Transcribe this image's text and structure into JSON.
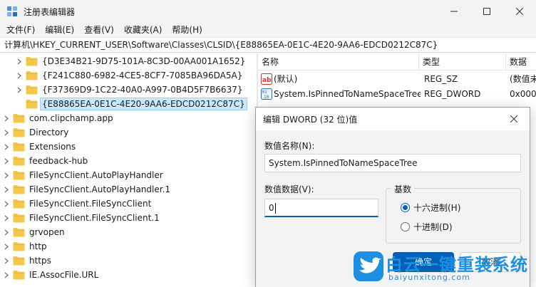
{
  "window": {
    "title": "注册表编辑器",
    "icon": "regedit-icon"
  },
  "menu": [
    "文件(F)",
    "编辑(E)",
    "查看(V)",
    "收藏夹(A)",
    "帮助(H)"
  ],
  "address": "计算机\\HKEY_CURRENT_USER\\Software\\Classes\\CLSID\\{E88865EA-0E1C-4E20-9AA6-EDCD0212C87C}",
  "tree": {
    "items": [
      {
        "label": "{D3E34B21-9D75-101A-8C3D-00AA001A1652}",
        "level": 2,
        "expander": true,
        "selected": false
      },
      {
        "label": "{F241C880-6982-4CE5-8CF7-7085BA96DA5A}",
        "level": 2,
        "expander": true,
        "selected": false
      },
      {
        "label": "{F37369D9-1C22-40A0-A997-0B4D5F7B6637}",
        "level": 2,
        "expander": true,
        "selected": false
      },
      {
        "label": "{E88865EA-0E1C-4E20-9AA6-EDCD0212C87C}",
        "level": 2,
        "expander": false,
        "selected": true
      },
      {
        "label": "com.clipchamp.app",
        "level": 1,
        "expander": true,
        "selected": false
      },
      {
        "label": "Directory",
        "level": 1,
        "expander": true,
        "selected": false
      },
      {
        "label": "Extensions",
        "level": 1,
        "expander": true,
        "selected": false
      },
      {
        "label": "feedback-hub",
        "level": 1,
        "expander": true,
        "selected": false
      },
      {
        "label": "FileSyncClient.AutoPlayHandler",
        "level": 1,
        "expander": true,
        "selected": false
      },
      {
        "label": "FileSyncClient.AutoPlayHandler.1",
        "level": 1,
        "expander": true,
        "selected": false
      },
      {
        "label": "FileSyncClient.FileSyncClient",
        "level": 1,
        "expander": true,
        "selected": false
      },
      {
        "label": "FileSyncClient.FileSyncClient.1",
        "level": 1,
        "expander": true,
        "selected": false
      },
      {
        "label": "grvopen",
        "level": 1,
        "expander": true,
        "selected": false
      },
      {
        "label": "http",
        "level": 1,
        "expander": true,
        "selected": false
      },
      {
        "label": "https",
        "level": 1,
        "expander": true,
        "selected": false
      },
      {
        "label": "IE.AssocFile.URL",
        "level": 1,
        "expander": true,
        "selected": false
      }
    ]
  },
  "list": {
    "columns": [
      "名称",
      "类型",
      "数据"
    ],
    "rows": [
      {
        "name": "(默认)",
        "type": "REG_SZ",
        "data": "(数值未",
        "icon": "string-value-icon"
      },
      {
        "name": "System.IsPinnedToNameSpaceTree",
        "type": "REG_DWORD",
        "data": "0x000",
        "icon": "dword-value-icon"
      }
    ]
  },
  "dialog": {
    "title": "编辑 DWORD (32 位)值",
    "name_label": "数值名称(N):",
    "name_value": "System.IsPinnedToNameSpaceTree",
    "data_label": "数值数据(V):",
    "data_value": "0",
    "base_label": "基数",
    "hex_label": "十六进制(H)",
    "dec_label": "十进制(D)",
    "selected_base": "hex",
    "ok_label": "确定",
    "cancel_label": "取消"
  },
  "watermark": {
    "text": "白云一键重装系统",
    "url": "baiyunxitong.com",
    "icon": "bird-logo-icon"
  },
  "colors": {
    "accent": "#005fb8",
    "selection": "#cce8ff",
    "folder": "#f2c94c",
    "watermark": "#1e8fe0"
  }
}
